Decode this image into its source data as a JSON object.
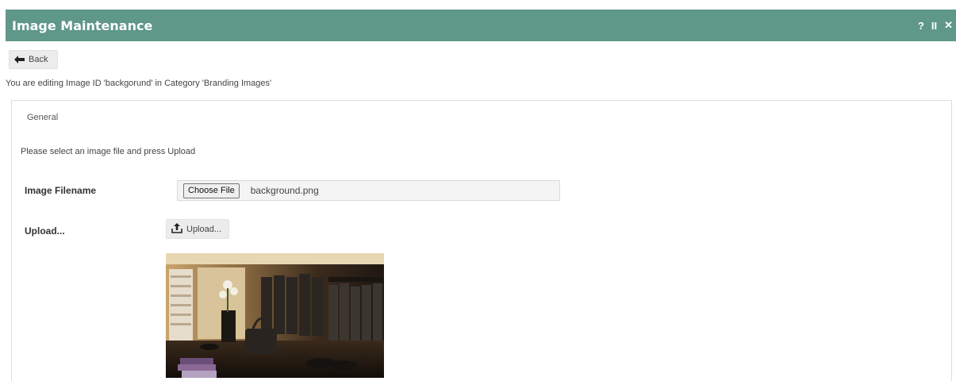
{
  "window": {
    "title": "Image Maintenance",
    "actions": {
      "help": "?",
      "pause": "II",
      "close": "✕"
    }
  },
  "toolbar": {
    "back_label": "Back"
  },
  "edit_info": "You are editing Image ID 'backgorund' in Category 'Branding Images'",
  "panel": {
    "tab_label": "General",
    "instruction": "Please select an image file and press Upload",
    "fields": {
      "filename_label": "Image Filename",
      "choose_file_label": "Choose File",
      "filename_value": "background.png",
      "upload_label": "Upload...",
      "upload_button_label": "Upload..."
    },
    "preview_icon": "clothing-store-photo"
  },
  "colors": {
    "titlebar": "#5f9789"
  }
}
